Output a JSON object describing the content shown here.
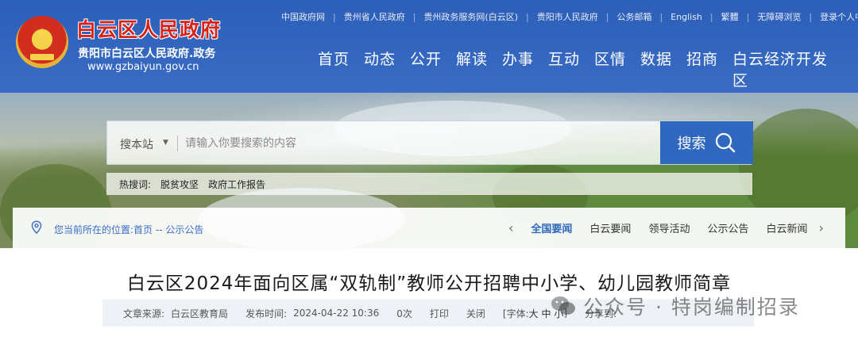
{
  "header": {
    "site_name": "白云区人民政府",
    "site_subtitle": "贵阳市白云区人民政府.政务",
    "site_url": "www.gzbaiyun.gov.cn",
    "top_links": [
      "中国政府网",
      "贵州省人民政府",
      "贵州政务服务网(白云区)",
      "贵阳市人民政府",
      "公务邮箱",
      "English",
      "繁體",
      "无障碍浏览",
      "登录个人中心"
    ],
    "nav": [
      "首页",
      "动态",
      "公开",
      "解读",
      "办事",
      "互动",
      "区情",
      "数据",
      "招商",
      "白云经济开发区"
    ]
  },
  "search": {
    "site_select": "搜本站",
    "placeholder": "请输入你要搜索的内容",
    "button_label": "搜索",
    "hot_label": "热搜词:",
    "hot_words": [
      "脱贫攻坚",
      "政府工作报告"
    ]
  },
  "breadcrumb": {
    "prefix": "您当前所在的位置:",
    "home": "首页",
    "separator": " -- ",
    "current": "公示公告"
  },
  "tabs": [
    "全国要闻",
    "白云要闻",
    "领导活动",
    "公示公告",
    "白云新闻"
  ],
  "article": {
    "title": "白云区2024年面向区属“双轨制”教师公开招聘中小学、幼儿园教师简章",
    "source_label": "文章来源:",
    "source": "白云区教育局",
    "date_label": "发布时间:",
    "date": "2024-04-22 10:36",
    "views": "0次",
    "print": "打印",
    "close": "关闭",
    "font_label": "[字体:",
    "font_large": "大",
    "font_medium": "中",
    "font_small": "小",
    "font_end": "]",
    "share_label": "分享到:"
  },
  "watermark": {
    "text": "公众号 · 特岗编制招录"
  },
  "colors": {
    "header_blue": "#2c5fb8",
    "title_red": "#d8231a",
    "search_blue": "#2f68be"
  }
}
